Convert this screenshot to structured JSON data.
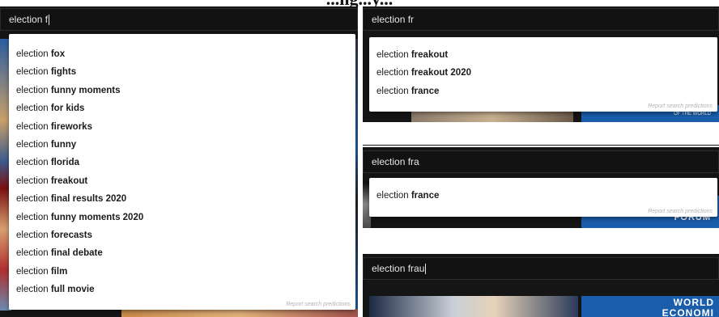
{
  "page_heading": "...ng...y...",
  "panel_left": {
    "query": "election f",
    "suggestions": [
      {
        "prefix": "election ",
        "rest": "fox"
      },
      {
        "prefix": "election ",
        "rest": "fights"
      },
      {
        "prefix": "election ",
        "rest": "funny moments"
      },
      {
        "prefix": "election ",
        "rest": "for kids"
      },
      {
        "prefix": "election ",
        "rest": "fireworks"
      },
      {
        "prefix": "election ",
        "rest": "funny"
      },
      {
        "prefix": "election ",
        "rest": "florida"
      },
      {
        "prefix": "election ",
        "rest": "freakout"
      },
      {
        "prefix": "election ",
        "rest": "final results 2020"
      },
      {
        "prefix": "election ",
        "rest": "funny moments 2020"
      },
      {
        "prefix": "election ",
        "rest": "forecasts"
      },
      {
        "prefix": "election ",
        "rest": "final debate"
      },
      {
        "prefix": "election ",
        "rest": "film"
      },
      {
        "prefix": "election ",
        "rest": "full movie"
      }
    ],
    "report_text": "Report search predictions"
  },
  "panel_right_1": {
    "query": "election fr",
    "suggestions": [
      {
        "prefix": "election ",
        "rest": "freakout"
      },
      {
        "prefix": "election ",
        "rest": "freakout 2020"
      },
      {
        "prefix": "election ",
        "rest": "france"
      }
    ],
    "report_text": "Report search predictions"
  },
  "panel_right_2": {
    "query": "election fra",
    "suggestions": [
      {
        "prefix": "election ",
        "rest": "france"
      }
    ],
    "report_text": "Report search predictions"
  },
  "panel_right_3": {
    "query": "election frau"
  },
  "thumb_texts": {
    "partial_world": "OF THE WORLD",
    "forum": "FORUM",
    "world": "WORLD",
    "economic": "ECONOMI"
  },
  "colors": {
    "dark_bg": "#151515",
    "search_bg": "#121212",
    "dropdown_bg": "#ffffff",
    "wef_blue": "#1a5dab"
  }
}
